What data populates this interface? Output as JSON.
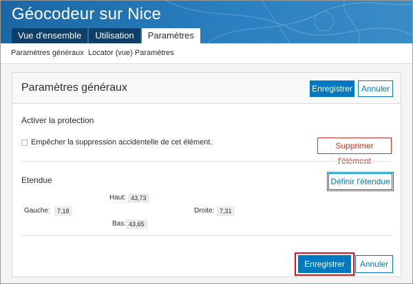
{
  "header": {
    "title": "Géocodeur sur Nice",
    "tabs": [
      {
        "label": "Vue d'ensemble",
        "active": false
      },
      {
        "label": "Utilisation",
        "active": false
      },
      {
        "label": "Paramètres",
        "active": true
      }
    ]
  },
  "subnav": {
    "items": [
      "Paramètres généraux",
      "Locator (vue) Paramètres"
    ]
  },
  "panel": {
    "title": "Paramètres généraux",
    "save_label": "Enregistrer",
    "cancel_label": "Annuler",
    "protection": {
      "heading": "Activer la protection",
      "checkbox_label": "Empêcher la suppression accidentelle de cet élément.",
      "checked": false,
      "delete_label": "Supprimer l'élément"
    },
    "extent": {
      "heading": "Etendue",
      "define_label": "Définir l'étendue",
      "top_label": "Haut:",
      "top_value": "43,73",
      "left_label": "Gauche:",
      "left_value": "7,18",
      "right_label": "Droite:",
      "right_value": "7,31",
      "bottom_label": "Bas:",
      "bottom_value": "43,65"
    },
    "footer": {
      "save_label": "Enregistrer",
      "cancel_label": "Annuler"
    }
  },
  "colors": {
    "header": "#1d6fad",
    "tab_dark": "#0f3f66",
    "primary": "#0079c1",
    "danger": "#d83020",
    "highlight": "#e0101a"
  }
}
